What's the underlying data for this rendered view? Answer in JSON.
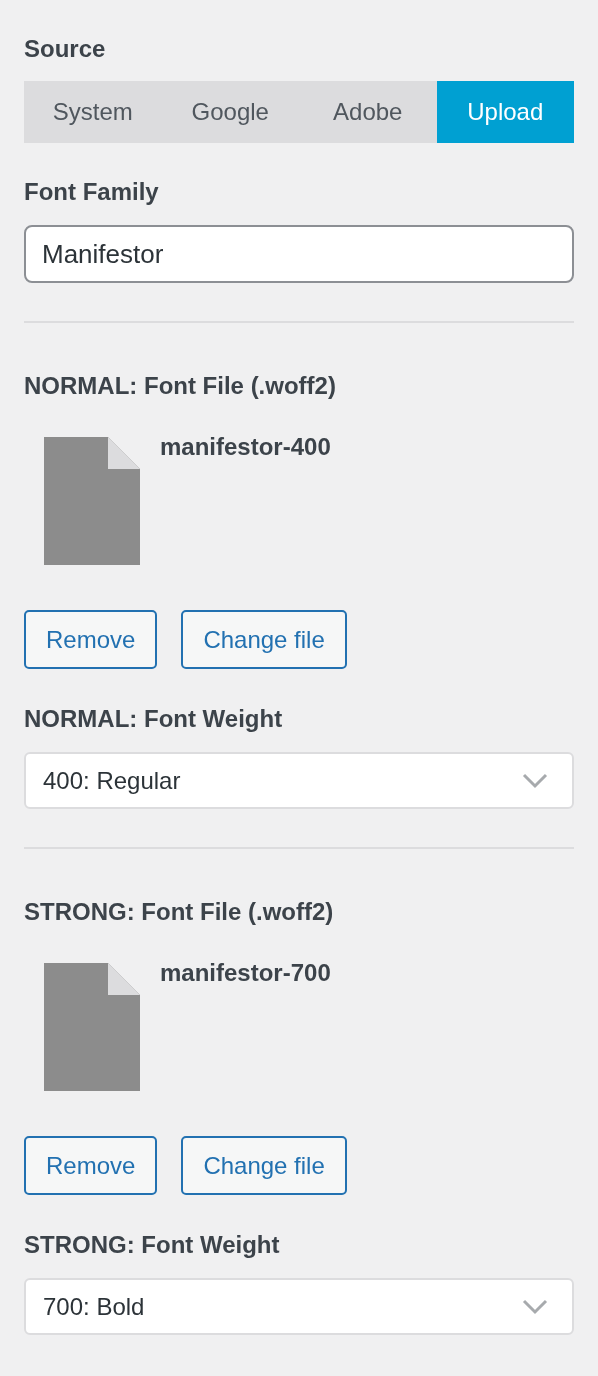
{
  "source": {
    "label": "Source",
    "options": [
      {
        "label": "System",
        "selected": false
      },
      {
        "label": "Google",
        "selected": false
      },
      {
        "label": "Adobe",
        "selected": false
      },
      {
        "label": "Upload",
        "selected": true
      }
    ]
  },
  "font_family": {
    "label": "Font Family",
    "value": "Manifestor"
  },
  "sections": [
    {
      "file_label": "NORMAL: Font File (.woff2)",
      "file_name": "manifestor-400",
      "buttons": [
        "Remove",
        "Change file"
      ],
      "weight_label": "NORMAL: Font Weight",
      "weight_value": "400: Regular"
    },
    {
      "file_label": "STRONG: Font File (.woff2)",
      "file_name": "manifestor-700",
      "buttons": [
        "Remove",
        "Change file"
      ],
      "weight_label": "STRONG: Font Weight",
      "weight_value": "700: Bold"
    }
  ]
}
